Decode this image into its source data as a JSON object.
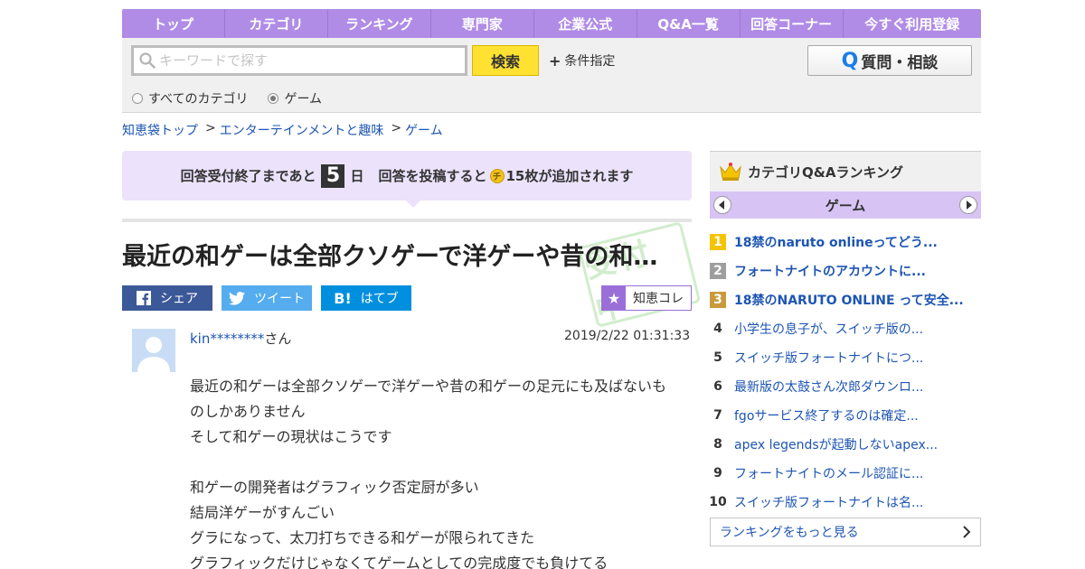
{
  "nav": {
    "items": [
      "トップ",
      "カテゴリ",
      "ランキング",
      "専門家",
      "企業公式",
      "Q&A一覧",
      "回答コーナー",
      "今すぐ利用登録"
    ]
  },
  "search": {
    "placeholder": "キーワードで探す",
    "button": "検索",
    "conditions": "条件指定",
    "ask_button": "質問・相談",
    "radios": [
      {
        "label": "すべてのカテゴリ",
        "checked": false
      },
      {
        "label": "ゲーム",
        "checked": true
      }
    ]
  },
  "breadcrumb": {
    "items": [
      "知恵袋トップ",
      "エンターテインメントと趣味",
      "ゲーム"
    ],
    "separator": ">"
  },
  "notice": {
    "prefix": "回答受付終了まであと",
    "days": "5",
    "day_unit": "日",
    "middle": "回答を投稿すると",
    "coin": "チ",
    "suffix": "15枚が追加されます"
  },
  "question": {
    "title": "最近の和ゲーは全部クソゲーで洋ゲーや昔の和…",
    "user": "kin********",
    "user_suffix": "さん",
    "datetime": "2019/2/22  01:31:33",
    "lines": [
      "最近の和ゲーは全部クソゲーで洋ゲーや昔の和ゲーの足元にも及ばないも",
      "のしかありません",
      "そして和ゲーの現状はこうです",
      "",
      "和ゲーの開発者はグラフィック否定厨が多い",
      "結局洋ゲーがすんごい",
      "グラになって、太刀打ちできる和ゲーが限られてきた",
      "グラフィックだけじゃなくてゲームとしての完成度でも負けてる"
    ]
  },
  "share": {
    "facebook": "シェア",
    "twitter": "ツイート",
    "hatena": "はてブ",
    "collect": "知恵コレ"
  },
  "sidebar": {
    "heading": "カテゴリQ&Aランキング",
    "category": "ゲーム",
    "rankings": [
      {
        "rank": "1",
        "title": "18禁のnaruto onlineってどう..."
      },
      {
        "rank": "2",
        "title": "フォートナイトのアカウントに..."
      },
      {
        "rank": "3",
        "title": "18禁のNARUTO ONLINE って安全..."
      },
      {
        "rank": "4",
        "title": "小学生の息子が、スイッチ版の..."
      },
      {
        "rank": "5",
        "title": "スイッチ版フォートナイトにつ..."
      },
      {
        "rank": "6",
        "title": "最新版の太鼓さん次郎ダウンロ..."
      },
      {
        "rank": "7",
        "title": "fgoサービス終了するのは確定..."
      },
      {
        "rank": "8",
        "title": "apex legendsが起動しないapex..."
      },
      {
        "rank": "9",
        "title": "フォートナイトのメール認証に..."
      },
      {
        "rank": "10",
        "title": "スイッチ版フォートナイトは名..."
      }
    ],
    "more": "ランキングをもっと見る"
  },
  "colors": {
    "nav_purple": "#b08ce6",
    "notice_bg": "#ece2fb",
    "search_yellow": "#ffe132",
    "link_blue": "#1d55b3",
    "rank_gold": "#f5c400",
    "rank_silver": "#9e9e9e",
    "rank_bronze": "#c99a3b"
  }
}
